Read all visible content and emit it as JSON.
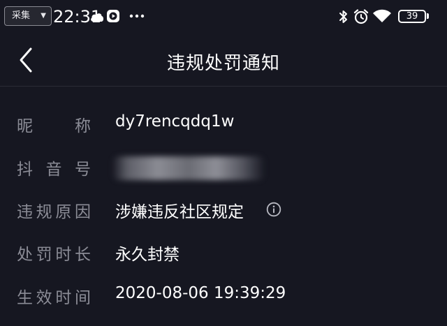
{
  "status_bar": {
    "collect_label": "采集",
    "time": "22:31",
    "battery": "39",
    "icons": [
      "cloud-icon",
      "play-icon",
      "more-dots-icon",
      "bluetooth-icon",
      "alarm-icon",
      "wifi-icon",
      "battery-icon"
    ]
  },
  "nav": {
    "back_icon": "chevron-left-icon",
    "title": "违规处罚通知"
  },
  "rows": [
    {
      "label_chars": [
        "昵",
        "称"
      ],
      "value": "dy7rencqdq1w"
    },
    {
      "label_chars": [
        "抖",
        "音",
        "号"
      ],
      "value_blurred": true
    },
    {
      "label_chars": [
        "违",
        "规",
        "原",
        "因"
      ],
      "value": "涉嫌违反社区规定",
      "trailing_icon": "info-icon"
    },
    {
      "label_chars": [
        "处",
        "罚",
        "时",
        "长"
      ],
      "value": "永久封禁"
    },
    {
      "label_chars": [
        "生",
        "效",
        "时",
        "间"
      ],
      "value": "2020-08-06 19:39:29"
    }
  ],
  "colors": {
    "background": "#161721",
    "label": "#8b8c96",
    "value": "#ffffff",
    "divider": "#2a2b35"
  }
}
